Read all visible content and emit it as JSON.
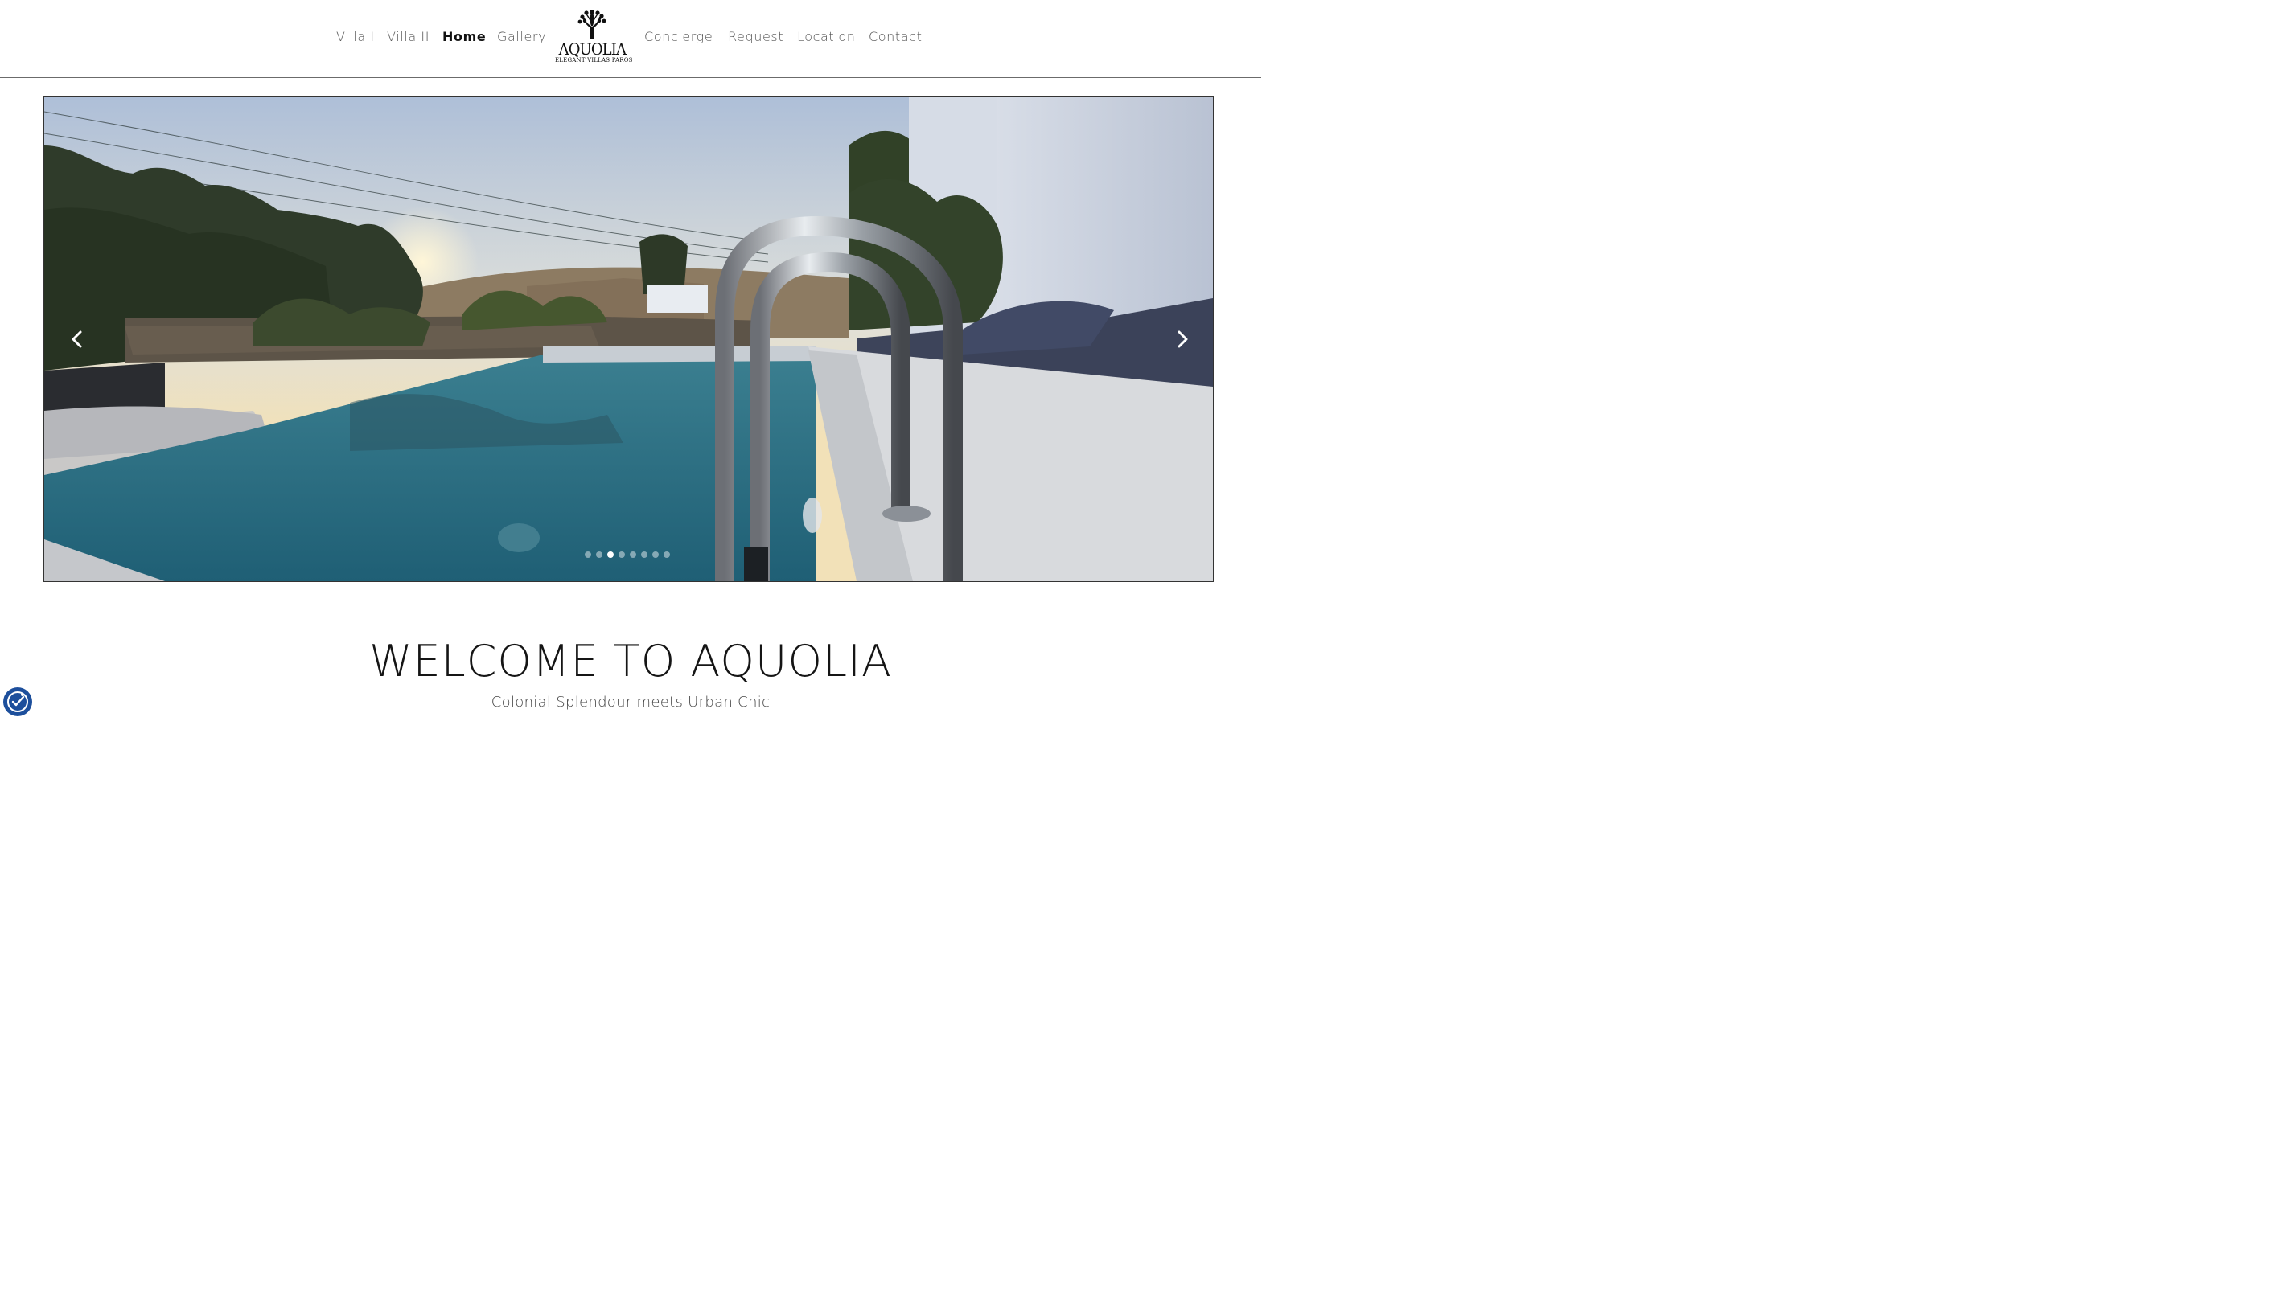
{
  "nav": {
    "left": [
      {
        "label": "Villa I"
      },
      {
        "label": "Villa II"
      },
      {
        "label": "Home",
        "active": true
      },
      {
        "label": "Gallery"
      }
    ],
    "right": [
      {
        "label": "Concierge"
      },
      {
        "label": "Request"
      },
      {
        "label": "Location"
      },
      {
        "label": "Contact"
      }
    ]
  },
  "logo": {
    "wordmark": "AQUOLIA",
    "subtitle": "ELEGANT VILLAS PAROS",
    "icon": "coral-tree-icon"
  },
  "slider": {
    "prev_icon": "chevron-left-icon",
    "next_icon": "chevron-right-icon",
    "slide_count": 8,
    "active_slide": 3
  },
  "welcome": {
    "title": "WELCOME TO AQUOLIA",
    "tagline": "Colonial Splendour meets Urban Chic"
  },
  "accessibility": {
    "icon": "accessibility-icon",
    "color": "#1d4f9c"
  }
}
